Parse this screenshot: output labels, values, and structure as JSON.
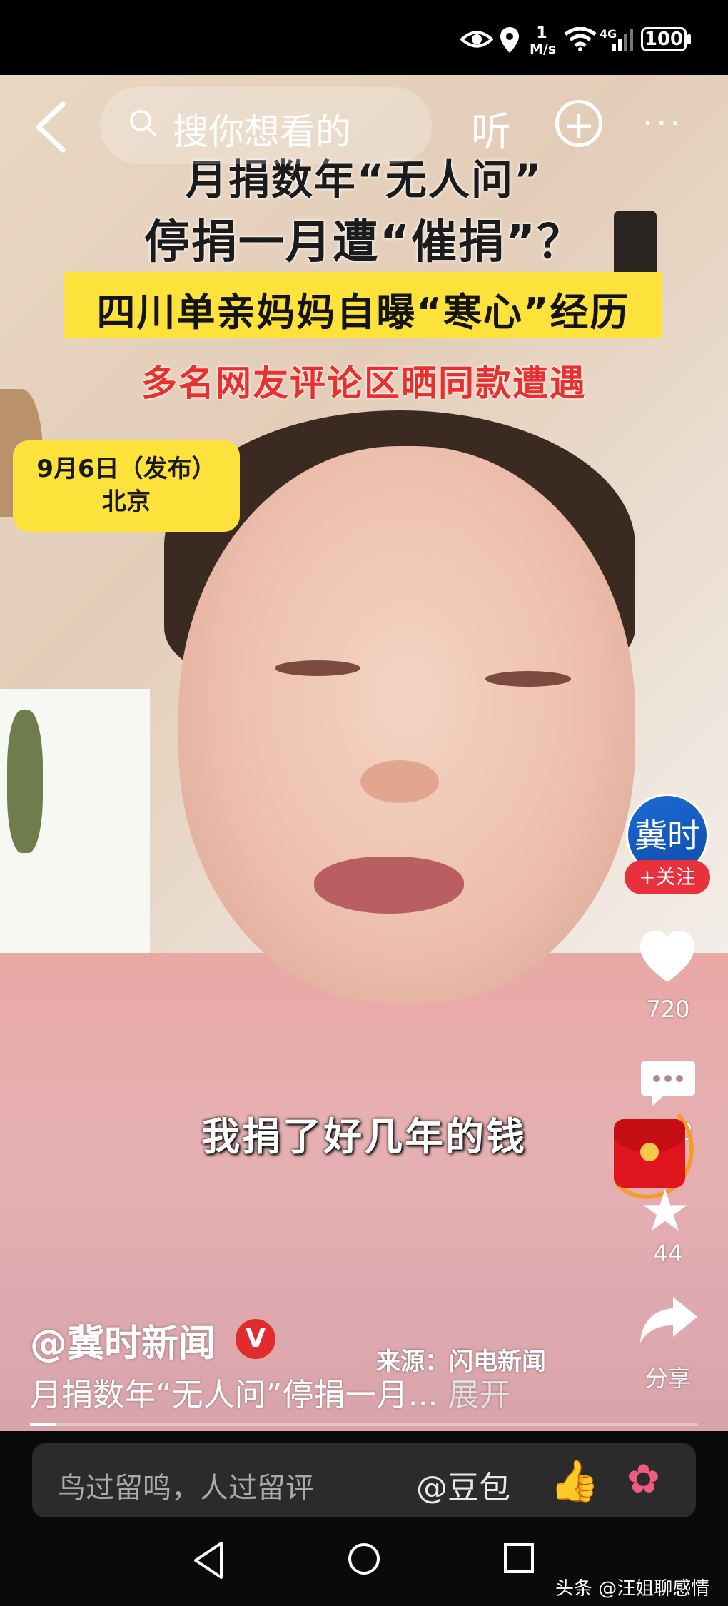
{
  "status_bar": {
    "network_speed": "1",
    "network_unit": "M/s",
    "signal_label": "4G",
    "battery": "100"
  },
  "top_bar": {
    "search_placeholder": "搜你想看的",
    "listen_label": "听"
  },
  "video_overlay": {
    "headline_line1": "月捐数年“无人问”",
    "headline_line2": "停捐一月遭“催捐”？",
    "headline_banner": "四川单亲妈妈自曝“寒心”经历",
    "headline_red": "多名网友评论区晒同款遭遇",
    "date_line1": "9月6日（发布）",
    "date_line2": "北京",
    "subtitle": "我捐了好几年的钱"
  },
  "side_actions": {
    "avatar_text": "冀时",
    "follow_label": "+关注",
    "like_count": "720",
    "comment_count": "3",
    "favorite_count": "44",
    "share_label": "分享"
  },
  "post_info": {
    "author": "@冀时新闻",
    "verified_mark": "V",
    "source": "来源：闪电新闻",
    "description": "月捐数年“无人问”停捐一月...",
    "expand_label": "展开",
    "progress_fraction": 0.04
  },
  "comment_bar": {
    "placeholder": "鸟过留鸣，人过留评",
    "mention": "@豆包"
  },
  "watermark": {
    "platform": "头条",
    "account": "@汪姐聊感情"
  },
  "colors": {
    "headline_yellow": "#fde23c",
    "headline_red": "#e8302e",
    "follow_red": "#e8313d",
    "avatar_blue": "#1c6bd6"
  }
}
